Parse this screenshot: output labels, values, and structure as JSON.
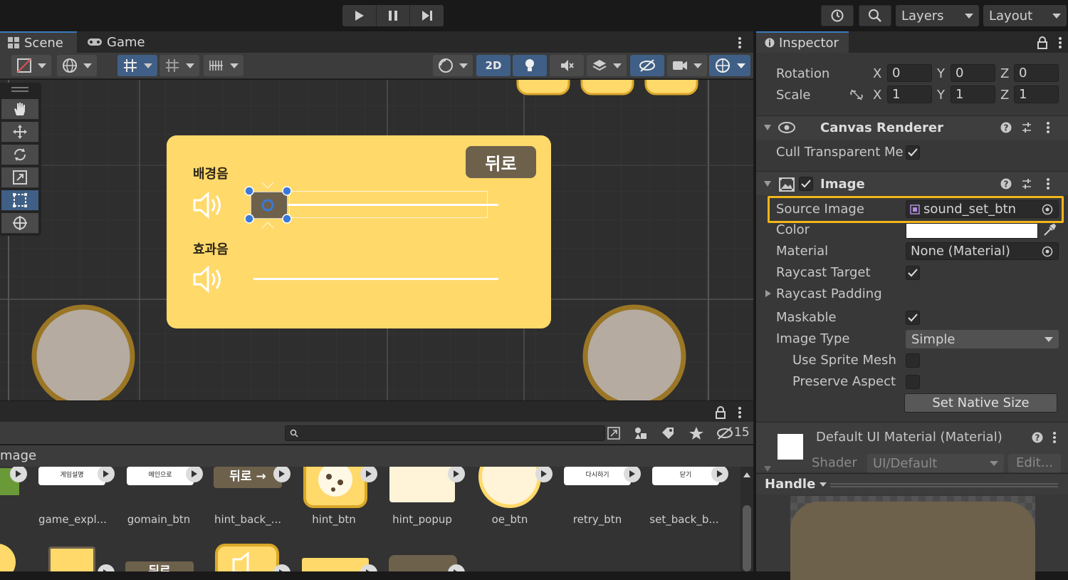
{
  "toolbar": {
    "layers_label": "Layers",
    "layout_label": "Layout"
  },
  "scene_tabs": {
    "scene": "Scene",
    "game": "Game"
  },
  "scene_toolbar": {
    "mode_2d": "2D"
  },
  "scene_popup": {
    "back_label": "뒤로",
    "bgm_label": "배경음",
    "sfx_label": "효과음",
    "bgm_slider": 0.05,
    "sfx_slider": 0.0
  },
  "project": {
    "breadcrumb": "mage",
    "hidden_count": "15",
    "search_value": "",
    "assets_row1": [
      {
        "label": "game_expl...",
        "thumb_text": "게임설명"
      },
      {
        "label": "gomain_btn",
        "thumb_text": "메인으로"
      },
      {
        "label": "hint_back_...",
        "thumb_text": "뒤로 →"
      },
      {
        "label": "hint_btn",
        "thumb_text": ""
      },
      {
        "label": "hint_popup",
        "thumb_text": ""
      },
      {
        "label": "oe_btn",
        "thumb_text": ""
      },
      {
        "label": "retry_btn",
        "thumb_text": "다시하기"
      },
      {
        "label": "set_back_b...",
        "thumb_text": "닫기"
      }
    ],
    "row2_thumb_text": "뒤로"
  },
  "inspector": {
    "tab_label": "Inspector",
    "rotation_label": "Rotation",
    "scale_label": "Scale",
    "rotation": {
      "x": "0",
      "y": "0",
      "z": "0"
    },
    "scale": {
      "x": "1",
      "y": "1",
      "z": "1"
    },
    "axis": {
      "x": "X",
      "y": "Y",
      "z": "Z"
    },
    "canvas_renderer": {
      "title": "Canvas Renderer",
      "cull_label": "Cull Transparent Me"
    },
    "image": {
      "title": "Image",
      "source_image_label": "Source Image",
      "source_image_value": "sound_set_btn",
      "color_label": "Color",
      "color_value": "#ffffff",
      "material_label": "Material",
      "material_value": "None (Material)",
      "raycast_target_label": "Raycast Target",
      "raycast_padding_label": "Raycast Padding",
      "maskable_label": "Maskable",
      "image_type_label": "Image Type",
      "image_type_value": "Simple",
      "use_sprite_mesh_label": "Use Sprite Mesh",
      "preserve_aspect_label": "Preserve Aspect",
      "set_native_size_label": "Set Native Size"
    },
    "material_section": {
      "title": "Default UI Material (Material)",
      "shader_label": "Shader",
      "shader_value": "UI/Default",
      "edit_label": "Edit..."
    },
    "preview": {
      "handle_label": "Handle"
    }
  },
  "colors": {
    "accent_blue": "#3f5f86",
    "highlight": "#f2b51b",
    "popup_yellow": "#ffd96a",
    "button_brown": "#6e614c"
  }
}
